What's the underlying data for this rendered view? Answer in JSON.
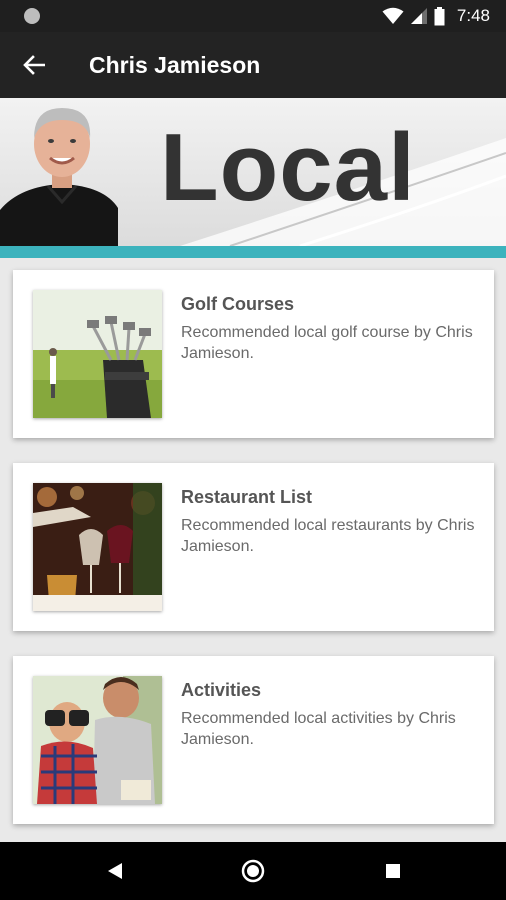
{
  "status_bar": {
    "time": "7:48",
    "icons": [
      "notification-dot-icon",
      "wifi-icon",
      "signal-icon",
      "battery-icon"
    ]
  },
  "app_bar": {
    "title": "Chris Jamieson",
    "back_icon": "arrow-back-icon"
  },
  "banner": {
    "text": "Local",
    "accent_color": "#3cb3bd"
  },
  "items": [
    {
      "title": "Golf Courses",
      "description": "Recommended local golf course by Chris Jamieson.",
      "thumbnail": "golf-bag-photo"
    },
    {
      "title": "Restaurant List",
      "description": "Recommended local restaurants by Chris Jamieson.",
      "thumbnail": "wine-glasses-photo"
    },
    {
      "title": "Activities",
      "description": "Recommended local activities by Chris Jamieson.",
      "thumbnail": "binoculars-photo"
    }
  ],
  "nav_bar": {
    "icons": [
      "back-triangle-icon",
      "home-circle-icon",
      "recents-square-icon"
    ]
  }
}
